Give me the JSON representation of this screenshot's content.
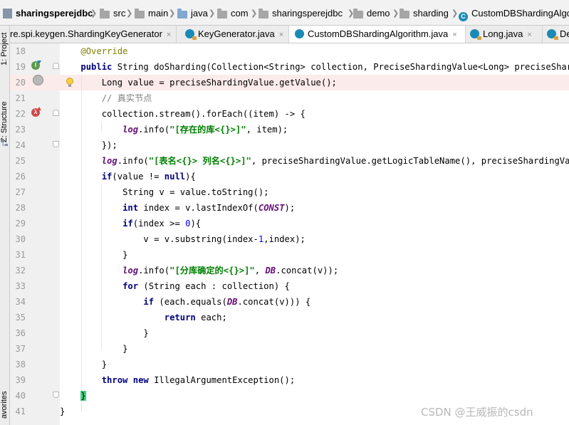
{
  "breadcrumbs": [
    "sharingsperejdbc",
    "src",
    "main",
    "java",
    "com",
    "sharingsperejdbc",
    "demo",
    "sharding",
    "CustomDBShardingAlgo"
  ],
  "tabs": [
    {
      "label": "re.spi.keygen.ShardingKeyGenerator",
      "close": "×",
      "active": false
    },
    {
      "label": "KeyGenerator.java",
      "close": "×",
      "active": false
    },
    {
      "label": "CustomDBShardingAlgorithm.java",
      "close": "×",
      "active": true
    },
    {
      "label": "Long.java",
      "close": "×",
      "active": false
    },
    {
      "label": "De",
      "close": "",
      "active": false
    }
  ],
  "side_tools": [
    "1: Project",
    "Z: Structure",
    "avorites"
  ],
  "line_numbers": [
    "18",
    "19",
    "20",
    "21",
    "22",
    "23",
    "24",
    "25",
    "26",
    "27",
    "28",
    "29",
    "30",
    "31",
    "32",
    "33",
    "34",
    "35",
    "36",
    "37",
    "38",
    "39",
    "40",
    "41"
  ],
  "code": {
    "l18": {
      "indent": "    ",
      "ann": "@Override"
    },
    "l19": {
      "indent": "    ",
      "kw": "public ",
      "text": "String doSharding(Collection<String> collection, PreciseShardingValue<Long> preciseSharding"
    },
    "l20": {
      "indent": "        ",
      "text": "Long value = preciseShardingValue.getValue();"
    },
    "l21": {
      "indent": "        ",
      "comment": "// 真实节点"
    },
    "l22": {
      "indent": "        ",
      "text": "collection.stream().forEach((item) -> {"
    },
    "l23": {
      "indent": "            ",
      "field": "log",
      "pre": ".info(",
      "str": "\"[存在的库<{}>]\"",
      "post": ", item);"
    },
    "l24": {
      "indent": "        ",
      "text": "});"
    },
    "l25": {
      "indent": "        ",
      "field": "log",
      "pre": ".info(",
      "str": "\"[表名<{}> 列名<{}>]\"",
      "post": ", preciseShardingValue.getLogicTableName(), preciseShardingVal"
    },
    "l26": {
      "indent": "        ",
      "kw": "if",
      "pre": "(value != ",
      "kw2": "null",
      "post": "){"
    },
    "l27": {
      "indent": "            ",
      "text": "String v = value.toString();"
    },
    "l28": {
      "indent": "            ",
      "kw": "int ",
      "pre": "index = v.lastIndexOf(",
      "field": "CONST",
      "post": ");"
    },
    "l29": {
      "indent": "            ",
      "kw": "if",
      "pre": "(index >= ",
      "num": "0",
      "post": "){"
    },
    "l30": {
      "indent": "                ",
      "pre": "v = v.substring(index-",
      "num": "1",
      "post": ",index);"
    },
    "l31": {
      "indent": "            ",
      "text": "}"
    },
    "l32": {
      "indent": "            ",
      "field": "log",
      "pre": ".info(",
      "str": "\"[分库确定的<{}>]\"",
      "mid": ", ",
      "field2": "DB",
      "post": ".concat(v));"
    },
    "l33": {
      "indent": "            ",
      "kw": "for ",
      "text": "(String each : collection) {"
    },
    "l34": {
      "indent": "                ",
      "kw": "if ",
      "pre": "(each.equals(",
      "field": "DB",
      "post": ".concat(v))) {"
    },
    "l35": {
      "indent": "                    ",
      "kw": "return ",
      "text": "each;"
    },
    "l36": {
      "indent": "                ",
      "text": "}"
    },
    "l37": {
      "indent": "            ",
      "text": "}"
    },
    "l38": {
      "indent": "        ",
      "text": "}"
    },
    "l39": {
      "indent": "        ",
      "kw": "throw new ",
      "text": "IllegalArgumentException();"
    },
    "l40": {
      "indent": "    ",
      "brace": "}"
    },
    "l41": {
      "indent": "",
      "text": "}"
    }
  },
  "watermark": "CSDN @王威振的csdn",
  "colors": {
    "keyword": "#000080",
    "string": "#008000",
    "field": "#660e7a",
    "annotation": "#808000",
    "comment": "#808080",
    "number": "#0000ff",
    "current_line": "#fcebeb",
    "brace_match": "#3fd17a"
  },
  "icons": [
    "project-icon",
    "folder-icon",
    "class-icon",
    "implements-gutter-icon",
    "overrides-gutter-icon",
    "breakpoint-icon",
    "intention-bulb-icon",
    "fold-icon"
  ]
}
